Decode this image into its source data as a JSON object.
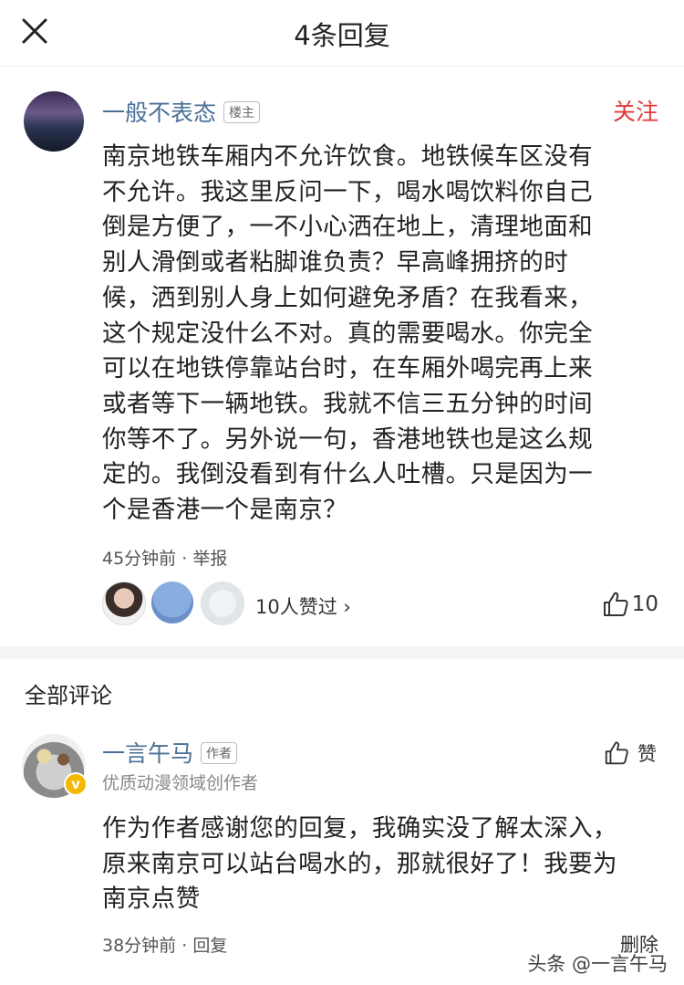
{
  "header": {
    "title": "4条回复"
  },
  "main_comment": {
    "username": "一般不表态",
    "badge": "楼主",
    "follow_label": "关注",
    "content": "南京地铁车厢内不允许饮食。地铁候车区没有\n不允许。我这里反问一下，喝水喝饮料你自己\n倒是方便了，一不小心洒在地上，清理地面和\n别人滑倒或者粘脚谁负责？早高峰拥挤的时\n候，洒到别人身上如何避免矛盾？在我看来，\n这个规定没什么不对。真的需要喝水。你完全\n可以在地铁停靠站台时，在车厢外喝完再上来\n或者等下一辆地铁。我就不信三五分钟的时间\n你等不了。另外说一句，香港地铁也是这么规\n定的。我倒没看到有什么人吐槽。只是因为一\n个是香港一个是南京？",
    "time": "45分钟前",
    "separator": " · ",
    "report_label": "举报",
    "likers_text": "10人赞过 ›",
    "like_count": "10"
  },
  "section_title": "全部评论",
  "reply": {
    "username": "一言午马",
    "badge": "作者",
    "subtitle": "优质动漫领域创作者",
    "like_label": "赞",
    "content": "作为作者感谢您的回复，我确实没了解太深入，\n原来南京可以站台喝水的，那就很好了！我要为\n南京点赞",
    "time": "38分钟前",
    "separator": " · ",
    "reply_label": "回复",
    "delete_label": "删除"
  },
  "watermark": "头条 @一言午马",
  "colors": {
    "link_blue": "#4a6f96",
    "follow_red": "#e03a3a",
    "divider_gray": "#f4f5f6",
    "verified_yellow": "#f5b800"
  }
}
